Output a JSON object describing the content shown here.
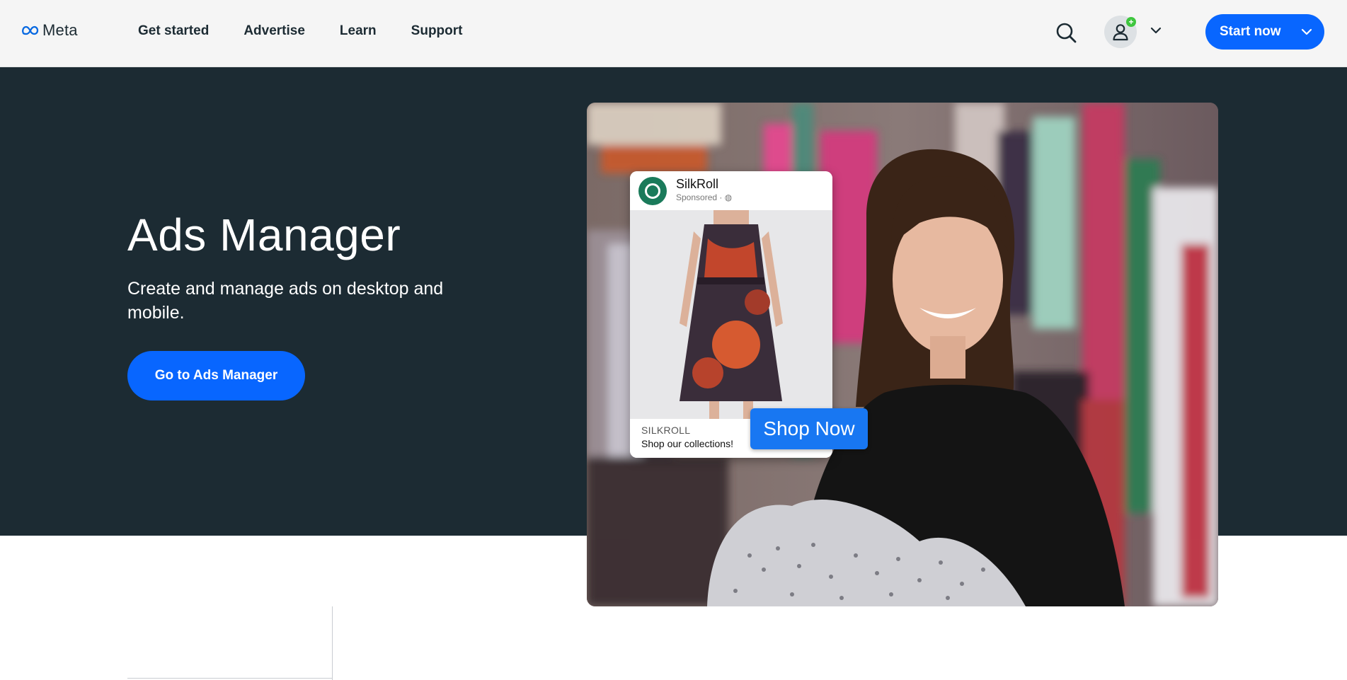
{
  "header": {
    "logo_text": "Meta",
    "nav": [
      {
        "label": "Get started"
      },
      {
        "label": "Advertise"
      },
      {
        "label": "Learn"
      },
      {
        "label": "Support"
      }
    ],
    "icons": {
      "search": "search-icon",
      "account": "person-icon",
      "chevron": "chevron-down-icon"
    },
    "account_badge": "+",
    "start_now_label": "Start now"
  },
  "hero": {
    "title": "Ads Manager",
    "subtitle": "Create and manage ads on desktop and mobile.",
    "cta_label": "Go to Ads Manager"
  },
  "ad_preview": {
    "brand_name": "SilkRoll",
    "sponsored": "Sponsored · ",
    "footer_brand": "SILKROLL",
    "footer_text": "Shop our collections!",
    "cta": "Shop Now"
  },
  "colors": {
    "accent": "#0866ff",
    "hero_bg": "#1c2b33",
    "header_bg": "#f5f5f5",
    "badge": "#3ec63e"
  }
}
